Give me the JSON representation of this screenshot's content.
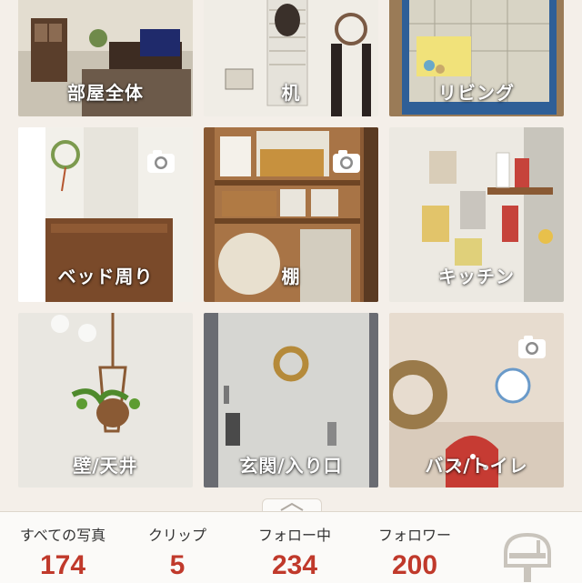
{
  "categories": [
    {
      "label": "部屋全体"
    },
    {
      "label": "机"
    },
    {
      "label": "リビング"
    },
    {
      "label": "ベッド周り"
    },
    {
      "label": "棚"
    },
    {
      "label": "キッチン"
    },
    {
      "label": "壁/天井"
    },
    {
      "label": "玄関/入り口"
    },
    {
      "label": "バス/トイレ"
    }
  ],
  "stats": {
    "photos": {
      "label": "すべての写真",
      "value": "174"
    },
    "clips": {
      "label": "クリップ",
      "value": "5"
    },
    "following": {
      "label": "フォロー中",
      "value": "234"
    },
    "followers": {
      "label": "フォロワー",
      "value": "200"
    }
  },
  "icons": {
    "camera": "camera-icon",
    "mailbox": "mailbox-icon",
    "expand": "chevron-up-icon"
  },
  "colors": {
    "accent": "#c0392b",
    "background": "#f4efe9"
  }
}
